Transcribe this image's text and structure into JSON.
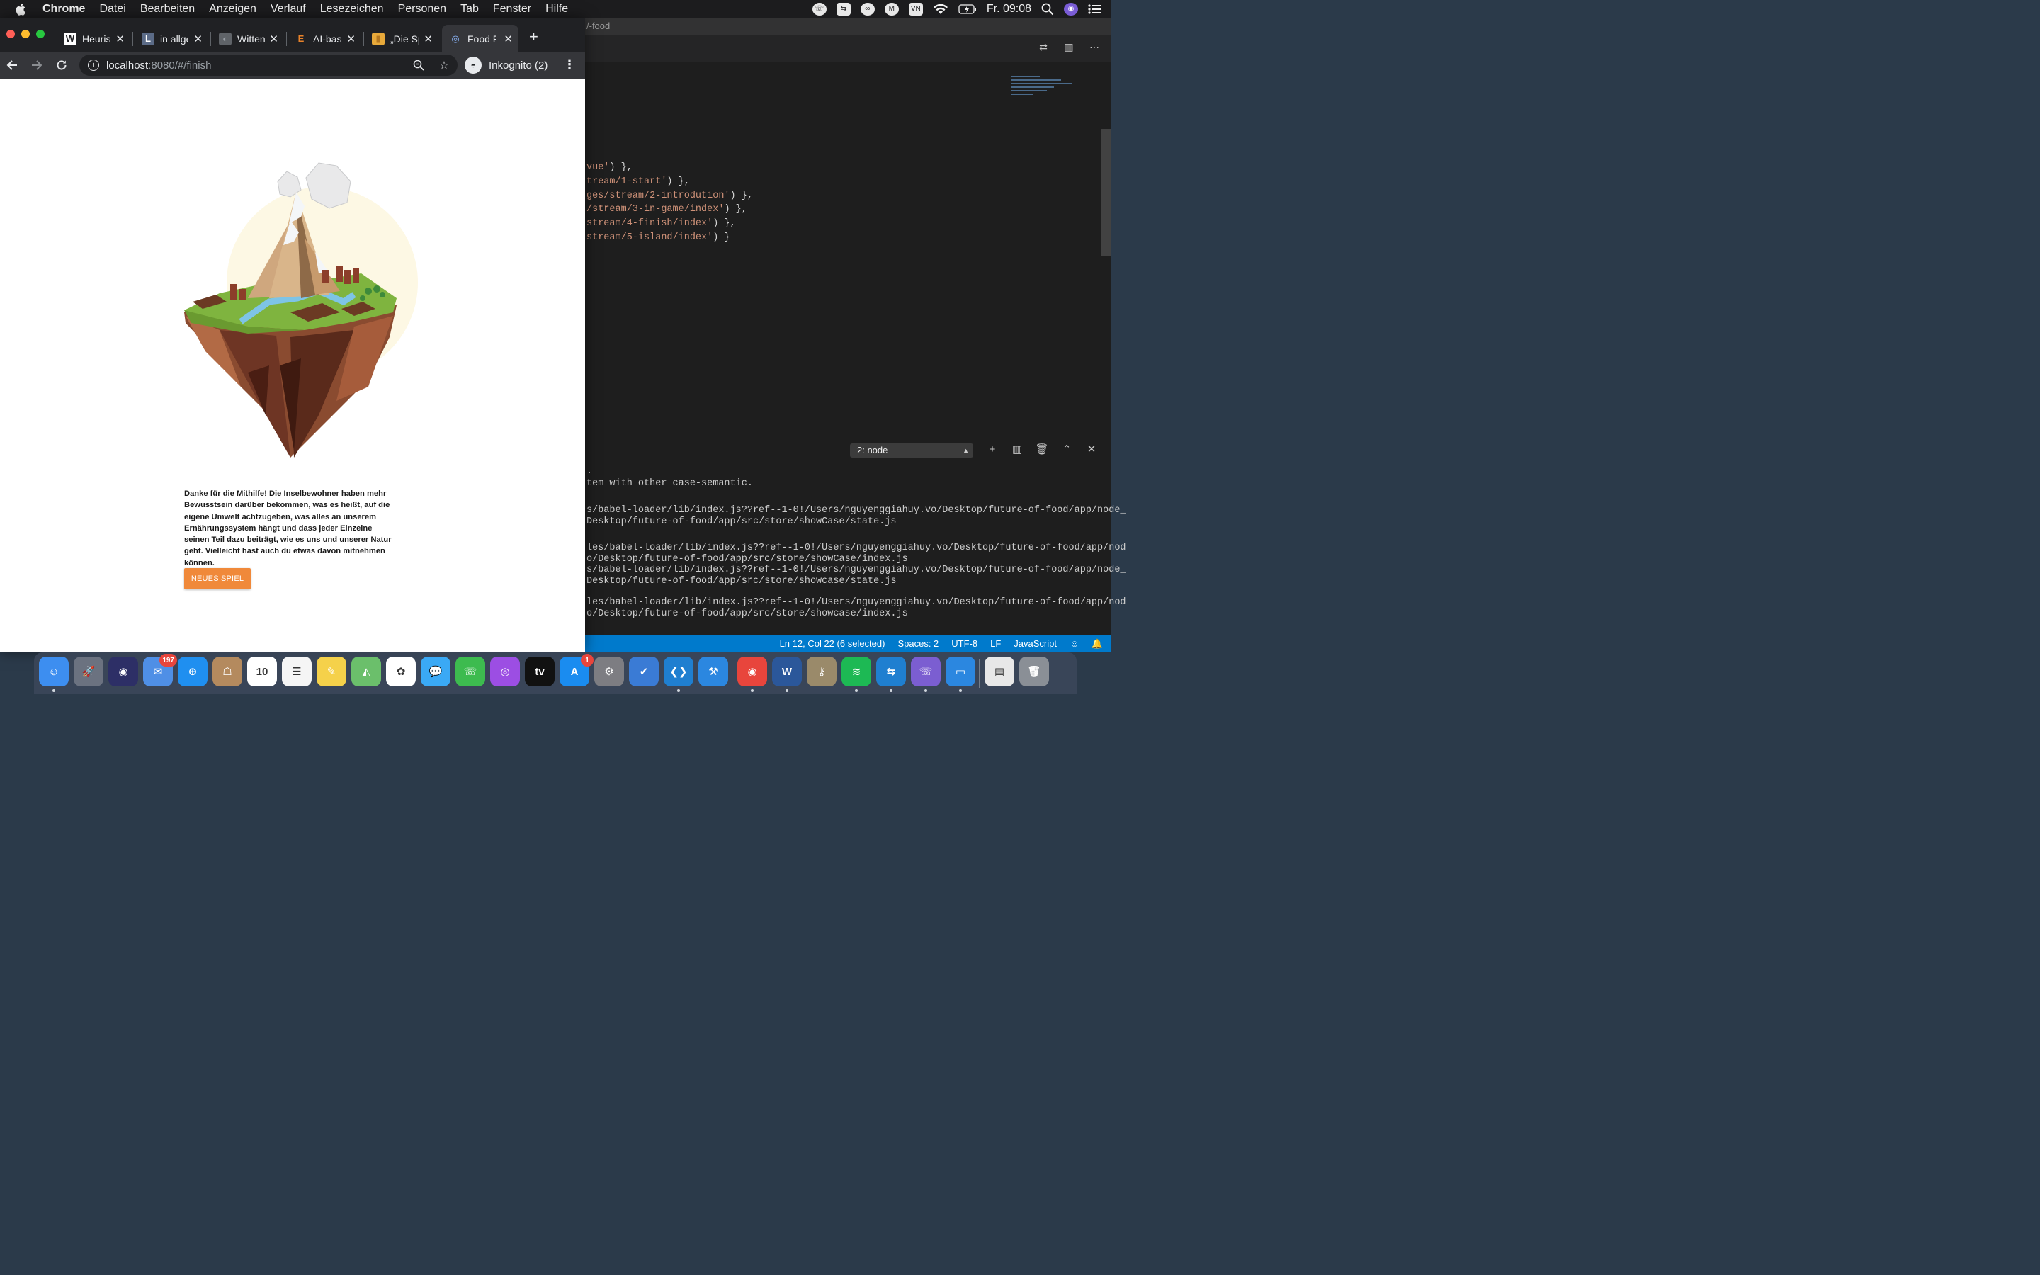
{
  "menubar": {
    "app": "Chrome",
    "items": [
      "Datei",
      "Bearbeiten",
      "Anzeigen",
      "Verlauf",
      "Lesezeichen",
      "Personen",
      "Tab",
      "Fenster",
      "Hilfe"
    ],
    "clock": "Fr. 09:08",
    "status_icons": [
      "viber-icon",
      "teamviewer-icon",
      "creative-cloud-icon",
      "malwarebytes-icon",
      "vietnamese-input-icon",
      "wifi-icon",
      "battery-icon",
      "search-icon",
      "siri-icon",
      "control-list-icon"
    ]
  },
  "chrome": {
    "tabs": [
      {
        "label": "Heuris",
        "favicon": "W",
        "favicon_bg": "#ffffff",
        "favicon_color": "#202124"
      },
      {
        "label": "in allge",
        "favicon": "L",
        "favicon_bg": "#5b6b87",
        "favicon_color": "#ffffff"
      },
      {
        "label": "Witten",
        "favicon": "◐",
        "favicon_bg": "#5f6368",
        "favicon_color": "#9aa0a6"
      },
      {
        "label": "AI-bas",
        "favicon": "E",
        "favicon_bg": "#202124",
        "favicon_color": "#e8822a"
      },
      {
        "label": "„Die Sp",
        "favicon": "▮",
        "favicon_bg": "#e8a93a",
        "favicon_color": "#b5771f"
      },
      {
        "label": "Food F",
        "favicon": "◎",
        "favicon_bg": "#35363a",
        "favicon_color": "#8ab4f8"
      }
    ],
    "url_host": "localhost",
    "url_path": ":8080/#/finish",
    "incognito_label": "Inkognito (2)"
  },
  "page": {
    "message": "Danke für die Mithilfe! Die Inselbewohner haben mehr Bewusstsein darüber bekommen, was es heißt, auf die eigene Umwelt achtzugeben, was alles an unserem Ernährungssystem hängt und dass jeder Einzelne seinen Teil dazu beiträgt, wie es uns und unserer Natur geht. Vielleicht hast auch du etwas davon mitnehmen können.",
    "button": "NEUES SPIEL",
    "button_color": "#f0893a"
  },
  "vscode": {
    "title_fragment": "/-food",
    "code_lines": [
      {
        "pre": "",
        "str": "vue'",
        "post": ") },"
      },
      {
        "pre": "",
        "str": "tream/1-start'",
        "post": ") },"
      },
      {
        "pre": "",
        "str": "ges/stream/2-introdution'",
        "post": ") },"
      },
      {
        "pre": "",
        "str": "/stream/3-in-game/index'",
        "post": ") },"
      },
      {
        "pre": "",
        "str": "stream/4-finish/index'",
        "post": ") },"
      },
      {
        "pre": "",
        "str": "stream/5-island/index'",
        "post": ") }"
      }
    ],
    "terminal_select": "2: node",
    "terminal_lines": [
      ".",
      "tem with other case-semantic.",
      "",
      "s/babel-loader/lib/index.js??ref--1-0!/Users/nguyenggiahuy.vo/Desktop/future-of-food/app/node_",
      "Desktop/future-of-food/app/src/store/showCase/state.js",
      "",
      "les/babel-loader/lib/index.js??ref--1-0!/Users/nguyenggiahuy.vo/Desktop/future-of-food/app/nod",
      "o/Desktop/future-of-food/app/src/store/showCase/index.js",
      "s/babel-loader/lib/index.js??ref--1-0!/Users/nguyenggiahuy.vo/Desktop/future-of-food/app/node_",
      "Desktop/future-of-food/app/src/store/showcase/state.js",
      "",
      "les/babel-loader/lib/index.js??ref--1-0!/Users/nguyenggiahuy.vo/Desktop/future-of-food/app/nod",
      "o/Desktop/future-of-food/app/src/store/showcase/index.js"
    ],
    "status": {
      "position": "Ln 12, Col 22 (6 selected)",
      "spaces": "Spaces: 2",
      "encoding": "UTF-8",
      "eol": "LF",
      "language": "JavaScript"
    }
  },
  "dock": {
    "apps": [
      {
        "name": "finder",
        "glyph": "☺",
        "bg": "#3d8ef0",
        "dot": true
      },
      {
        "name": "launchpad",
        "glyph": "🚀",
        "bg": "#6b7280",
        "dot": false
      },
      {
        "name": "siri",
        "glyph": "◉",
        "bg": "#2d2f66",
        "dot": false
      },
      {
        "name": "mail",
        "glyph": "✉",
        "bg": "#4f8fe6",
        "dot": false,
        "badge": "197"
      },
      {
        "name": "safari",
        "glyph": "⊕",
        "bg": "#1f8ff0",
        "dot": false
      },
      {
        "name": "contacts",
        "glyph": "☖",
        "bg": "#b48a5e",
        "dot": false
      },
      {
        "name": "calendar",
        "glyph": "10",
        "bg": "#ffffff",
        "dot": false
      },
      {
        "name": "reminders",
        "glyph": "☰",
        "bg": "#f5f5f5",
        "dot": false
      },
      {
        "name": "notes",
        "glyph": "✎",
        "bg": "#f5d14a",
        "dot": false
      },
      {
        "name": "maps",
        "glyph": "◭",
        "bg": "#6bbf6b",
        "dot": false
      },
      {
        "name": "photos",
        "glyph": "✿",
        "bg": "#ffffff",
        "dot": false
      },
      {
        "name": "messages",
        "glyph": "💬",
        "bg": "#3aa9f5",
        "dot": false
      },
      {
        "name": "facetime",
        "glyph": "☏",
        "bg": "#3dbb4f",
        "dot": false
      },
      {
        "name": "podcasts",
        "glyph": "◎",
        "bg": "#9c4ee3",
        "dot": false
      },
      {
        "name": "apple-tv",
        "glyph": "tv",
        "bg": "#111111",
        "dot": false
      },
      {
        "name": "app-store",
        "glyph": "A",
        "bg": "#1a8cf0",
        "dot": false,
        "badge": "1"
      },
      {
        "name": "system-preferences",
        "glyph": "⚙",
        "bg": "#7d7d82",
        "dot": false
      },
      {
        "name": "things",
        "glyph": "✔",
        "bg": "#3a7bd5",
        "dot": false
      },
      {
        "name": "vscode",
        "glyph": "❮❯",
        "bg": "#1f7fd0",
        "dot": true
      },
      {
        "name": "xcode",
        "glyph": "⚒",
        "bg": "#2b87e0",
        "dot": false
      },
      {
        "name": "chrome",
        "glyph": "◉",
        "bg": "#e8453c",
        "dot": true
      },
      {
        "name": "word",
        "glyph": "W",
        "bg": "#2b579a",
        "dot": true
      },
      {
        "name": "keychain",
        "glyph": "⚷",
        "bg": "#9a8a6a",
        "dot": false
      },
      {
        "name": "spotify",
        "glyph": "≋",
        "bg": "#1db954",
        "dot": true
      },
      {
        "name": "teamviewer",
        "glyph": "⇆",
        "bg": "#1f7fd0",
        "dot": true
      },
      {
        "name": "viber",
        "glyph": "☏",
        "bg": "#7b5ed1",
        "dot": true
      },
      {
        "name": "simulator",
        "glyph": "▭",
        "bg": "#2b87e0",
        "dot": true
      },
      {
        "name": "documents",
        "glyph": "▤",
        "bg": "#e8e8e8",
        "dot": false
      },
      {
        "name": "trash",
        "glyph": "🗑",
        "bg": "#8a8f96",
        "dot": false
      }
    ]
  }
}
